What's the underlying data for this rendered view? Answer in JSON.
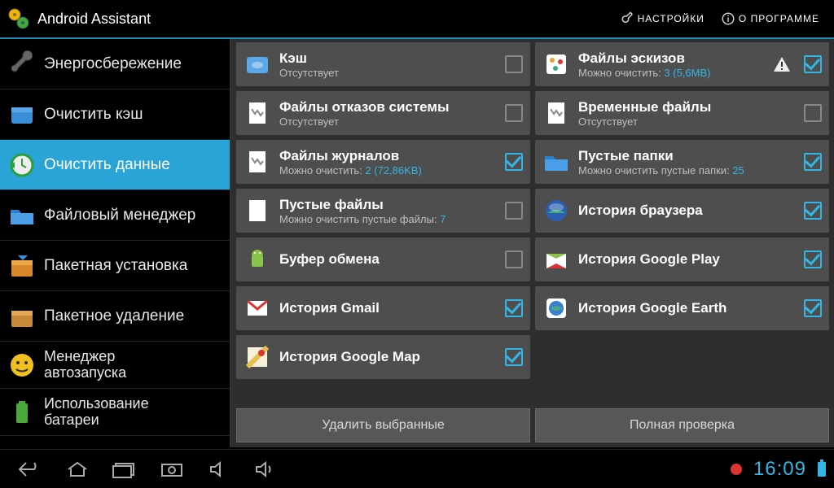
{
  "topbar": {
    "title": "Android Assistant",
    "settings": "НАСТРОЙКИ",
    "about": "О ПРОГРАММЕ"
  },
  "sidebar": {
    "items": [
      {
        "label": "Энергосбережение",
        "icon": "wrench"
      },
      {
        "label": "Очистить кэш",
        "icon": "box-blue"
      },
      {
        "label": "Очистить данные",
        "icon": "clock-green",
        "active": true
      },
      {
        "label": "Файловый менеджер",
        "icon": "folder-blue"
      },
      {
        "label": "Пакетная установка",
        "icon": "box-orange"
      },
      {
        "label": "Пакетное удаление",
        "icon": "box-brown"
      },
      {
        "label1": "Менеджер",
        "label2": "автозапуска",
        "icon": "face"
      },
      {
        "label1": "Использование",
        "label2": "батареи",
        "icon": "battery"
      }
    ]
  },
  "cards_left": [
    {
      "title": "Кэш",
      "sub": "Отсутствует",
      "checked": false,
      "icon": "cache"
    },
    {
      "title": "Файлы отказов системы",
      "sub": "Отсутствует",
      "checked": false,
      "icon": "doc"
    },
    {
      "title": "Файлы журналов",
      "sub_prefix": "Можно очистить: ",
      "sub_value": "2 (72,86KB)",
      "checked": true,
      "icon": "doc"
    },
    {
      "title": "Пустые файлы",
      "sub_prefix": "Можно очистить пустые файлы: ",
      "sub_value": "7",
      "checked": false,
      "icon": "blank"
    },
    {
      "title": "Буфер обмена",
      "checked": false,
      "icon": "android"
    },
    {
      "title": "История Gmail",
      "checked": true,
      "icon": "gmail"
    },
    {
      "title": "История Google Map",
      "checked": true,
      "icon": "gmap"
    }
  ],
  "cards_right": [
    {
      "title": "Файлы эскизов",
      "sub_prefix": "Можно очистить: ",
      "sub_value": "3 (5,6MB)",
      "checked": true,
      "warn": true,
      "icon": "thumb"
    },
    {
      "title": "Временные файлы",
      "sub": "Отсутствует",
      "checked": false,
      "icon": "doc"
    },
    {
      "title": "Пустые папки",
      "sub_prefix": "Можно очистить пустые папки: ",
      "sub_value": "25",
      "checked": true,
      "icon": "folder"
    },
    {
      "title": "История браузера",
      "checked": true,
      "icon": "browser"
    },
    {
      "title": "История Google Play",
      "checked": true,
      "icon": "play"
    },
    {
      "title": "История Google Earth",
      "checked": true,
      "icon": "earth"
    }
  ],
  "actions": {
    "delete": "Удалить выбранные",
    "full": "Полная проверка"
  },
  "navbar": {
    "time": "16:09"
  }
}
